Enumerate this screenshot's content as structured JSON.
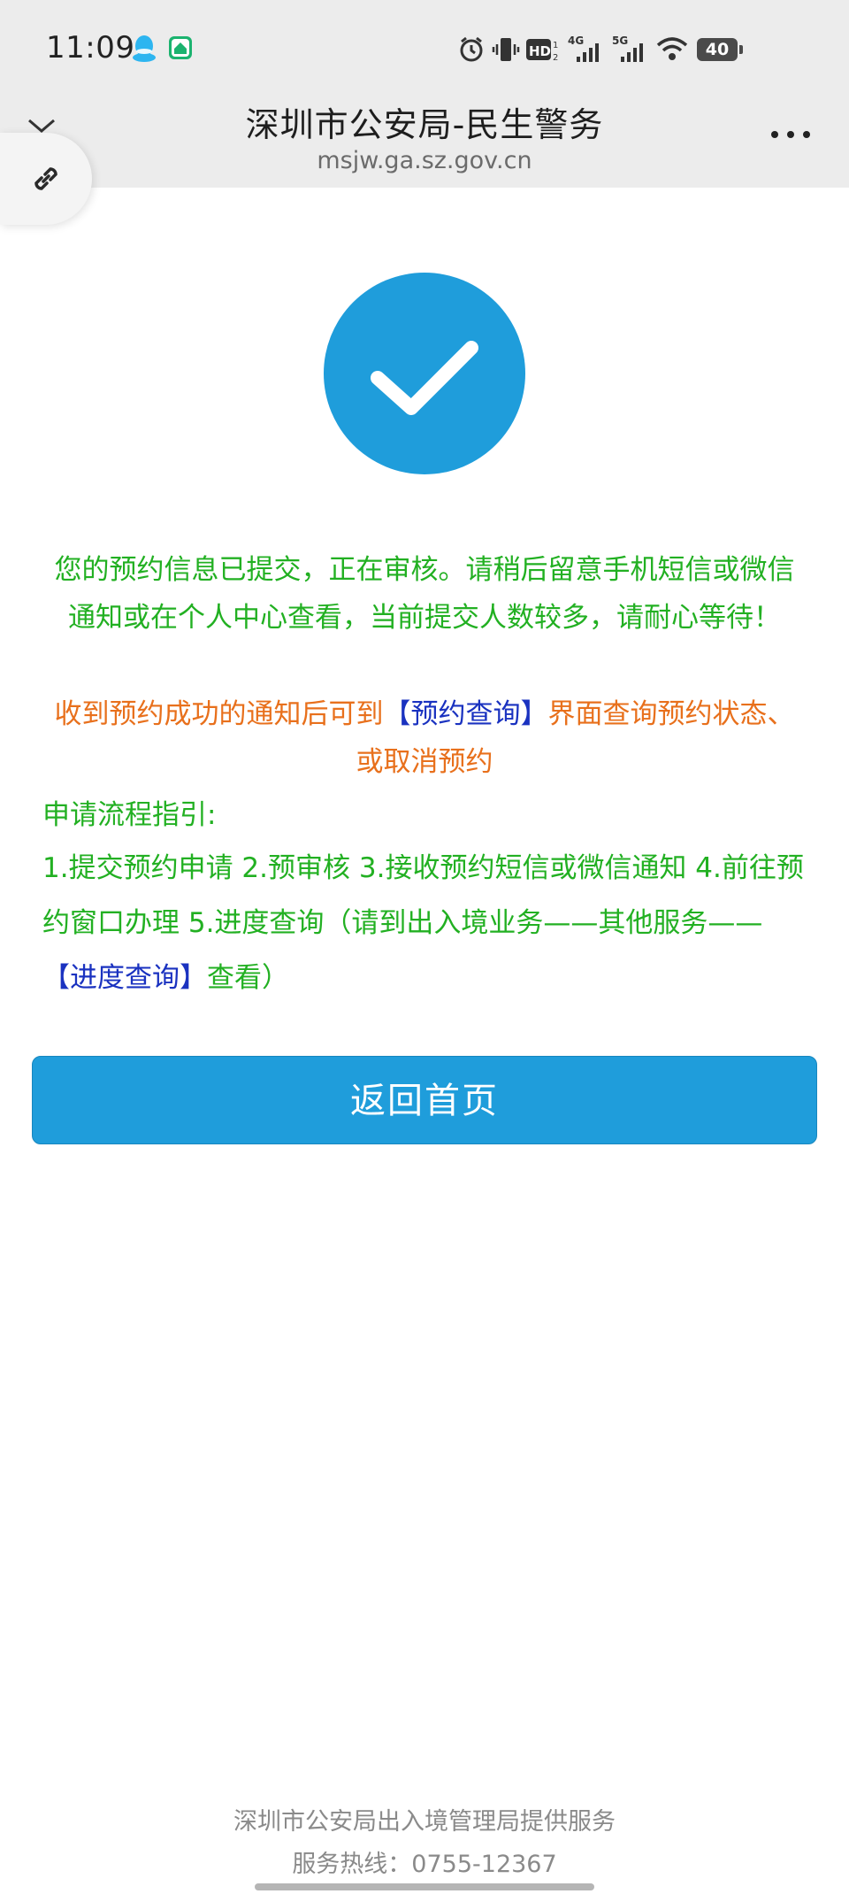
{
  "status_bar": {
    "time": "11:09",
    "battery": "40",
    "icons": [
      "qq-icon",
      "app-icon",
      "alarm-icon",
      "vibrate-icon",
      "hd-icon",
      "4g-signal-icon",
      "5g-signal-icon",
      "wifi-icon",
      "battery-icon"
    ]
  },
  "header": {
    "title": "深圳市公安局-民生警务",
    "url": "msjw.ga.sz.gov.cn"
  },
  "message": {
    "line1": "您的预约信息已提交，正在审核。请稍后留意手机短信或微信通知或在个人中心查看，当前提交人数较多，请耐心等待！",
    "line2_before": "收到预约成功的通知后可到",
    "line2_link": "【预约查询】",
    "line2_after": "界面查询预约状态、或取消预约"
  },
  "guide": {
    "title": "申请流程指引:",
    "text_before": "1.提交预约申请 2.预审核 3.接收预约短信或微信通知 4.前往预约窗口办理 5.进度查询（请到出入境业务——其他服务——",
    "text_link": "【进度查询】",
    "text_after": "查看）"
  },
  "button": {
    "home_label": "返回首页"
  },
  "footer": {
    "provider": "深圳市公安局出入境管理局提供服务",
    "hotline": "服务热线：0755-12367"
  },
  "colors": {
    "accent": "#1f9ddb",
    "success_text": "#22b022",
    "notice_text": "#e8701c",
    "link_text": "#1a32c0"
  }
}
